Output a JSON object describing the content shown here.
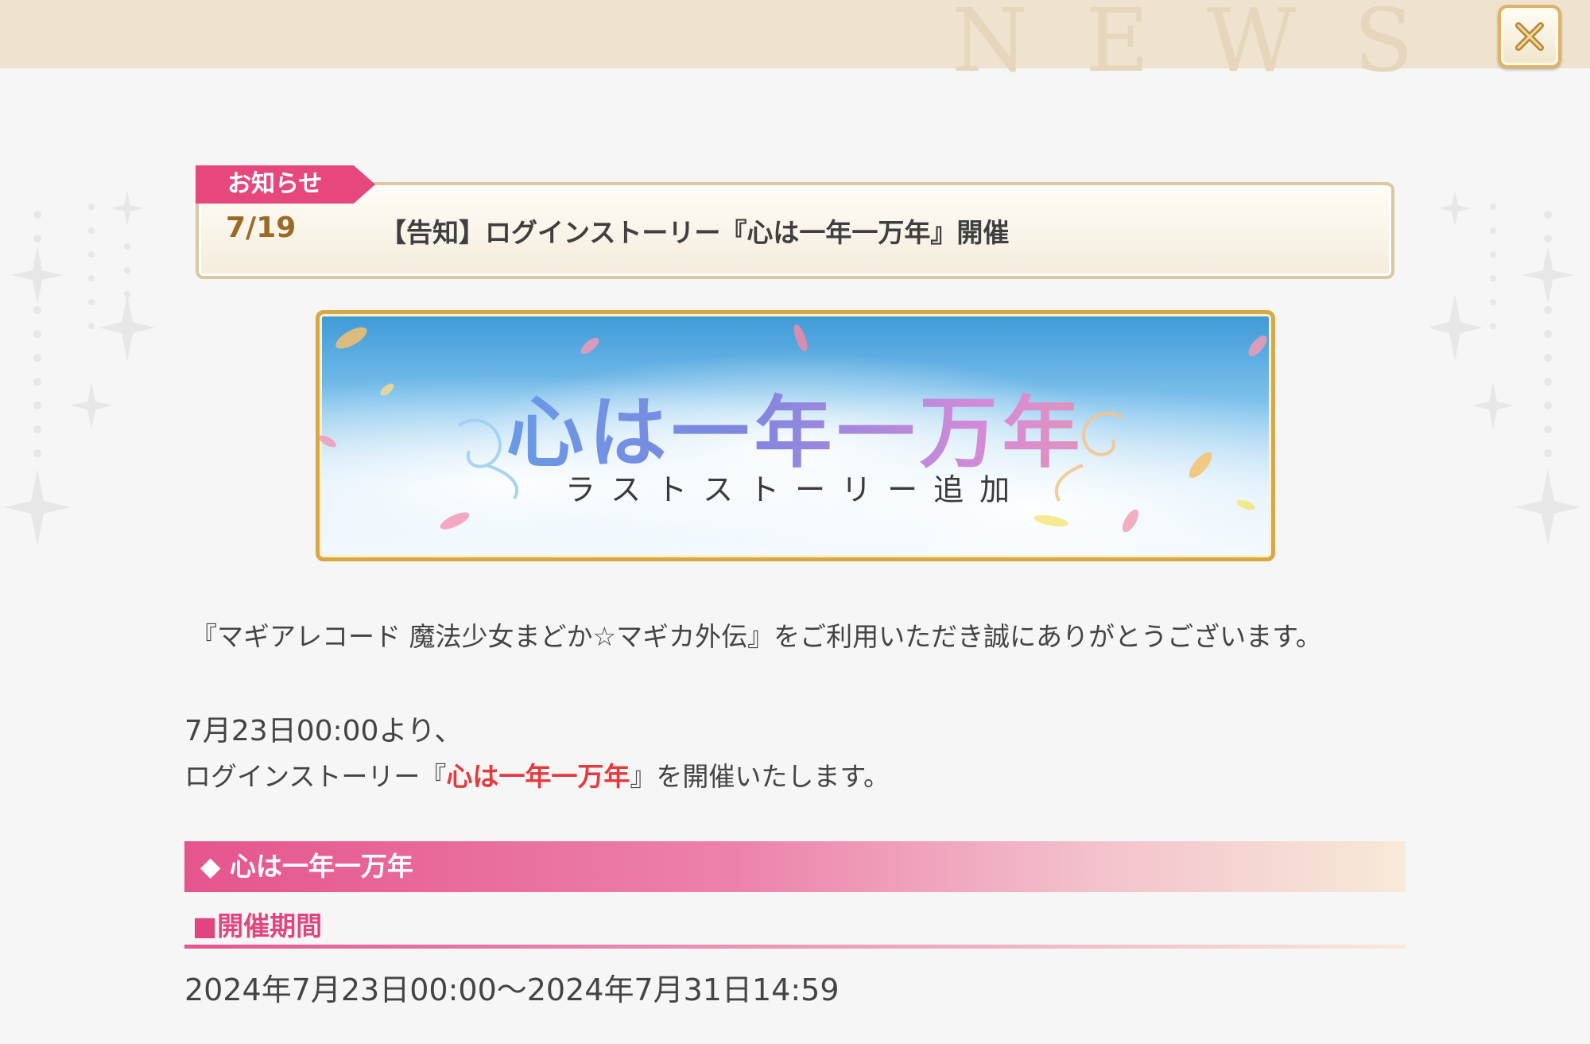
{
  "header": {
    "watermark": "NEWS",
    "close_icon": "close-x-icon"
  },
  "notice": {
    "tag": "お知らせ",
    "date": "7/19",
    "title": "【告知】ログインストーリー『心は一年一万年』開催"
  },
  "banner": {
    "title": "心は一年一万年",
    "subtitle": "ラストストーリー追加"
  },
  "body": {
    "intro": "『マギアレコード 魔法少女まどか☆マギカ外伝』をご利用いただき誠にありがとうございます。",
    "start_line": "7月23日00:00より、",
    "event_prefix": "ログインストーリー『",
    "event_name": "心は一年一万年",
    "event_suffix": "』を開催いたします。"
  },
  "section": {
    "heading": "◆ 心は一年一万年",
    "period_label": "■開催期間",
    "period_value": "2024年7月23日00:00～2024年7月31日14:59"
  },
  "colors": {
    "accent_pink": "#e6477d",
    "highlight_red": "#e5393e",
    "frame_gold": "#d7a845"
  }
}
